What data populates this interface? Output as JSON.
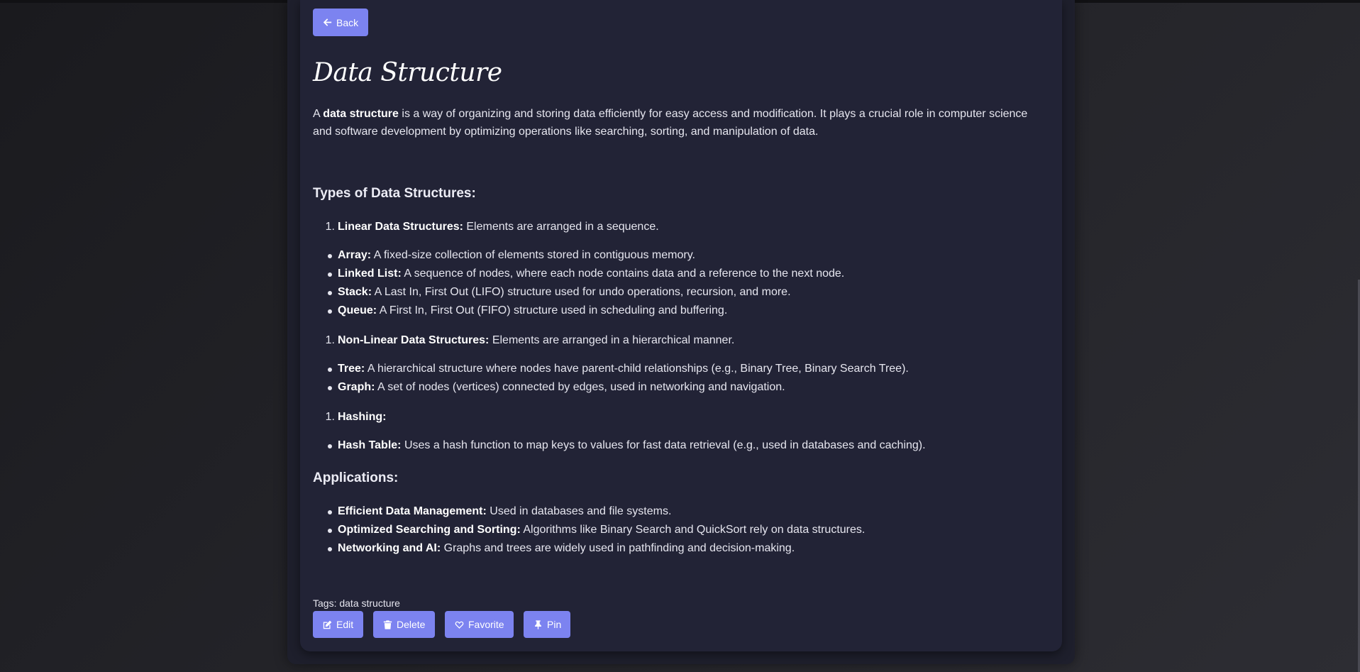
{
  "nav": {
    "back_label": "Back"
  },
  "article": {
    "title": "Data Structure",
    "intro": {
      "pre": "A ",
      "bold": "data structure",
      "post": " is a way of organizing and storing data efficiently for easy access and modification. It plays a crucial role in computer science and software development by optimizing operations like searching, sorting, and manipulation of data."
    },
    "types_heading": "Types of Data Structures:",
    "groups": [
      {
        "number": "1.",
        "label": "Linear Data Structures:",
        "text": " Elements are arranged in a sequence.",
        "items": [
          {
            "label": "Array:",
            "text": " A fixed-size collection of elements stored in contiguous memory."
          },
          {
            "label": "Linked List:",
            "text": " A sequence of nodes, where each node contains data and a reference to the next node."
          },
          {
            "label": "Stack:",
            "text": " A Last In, First Out (LIFO) structure used for undo operations, recursion, and more."
          },
          {
            "label": "Queue:",
            "text": " A First In, First Out (FIFO) structure used in scheduling and buffering."
          }
        ]
      },
      {
        "number": "1.",
        "label": "Non-Linear Data Structures:",
        "text": " Elements are arranged in a hierarchical manner.",
        "items": [
          {
            "label": "Tree:",
            "text": " A hierarchical structure where nodes have parent-child relationships (e.g., Binary Tree, Binary Search Tree)."
          },
          {
            "label": "Graph:",
            "text": " A set of nodes (vertices) connected by edges, used in networking and navigation."
          }
        ]
      },
      {
        "number": "1.",
        "label": "Hashing:",
        "text": "",
        "items": [
          {
            "label": "Hash Table:",
            "text": " Uses a hash function to map keys to values for fast data retrieval (e.g., used in databases and caching)."
          }
        ]
      }
    ],
    "applications_heading": "Applications:",
    "applications": [
      {
        "label": "Efficient Data Management:",
        "text": " Used in databases and file systems."
      },
      {
        "label": "Optimized Searching and Sorting:",
        "text": " Algorithms like Binary Search and QuickSort rely on data structures."
      },
      {
        "label": "Networking and AI:",
        "text": " Graphs and trees are widely used in pathfinding and decision-making."
      }
    ],
    "tags_text": "Tags: data structure"
  },
  "actions": {
    "edit_label": "Edit",
    "delete_label": "Delete",
    "favorite_label": "Favorite",
    "pin_label": "Pin"
  },
  "colors": {
    "accent": "#7c83f0",
    "card": "#222336",
    "panel": "#1e1f2c"
  }
}
